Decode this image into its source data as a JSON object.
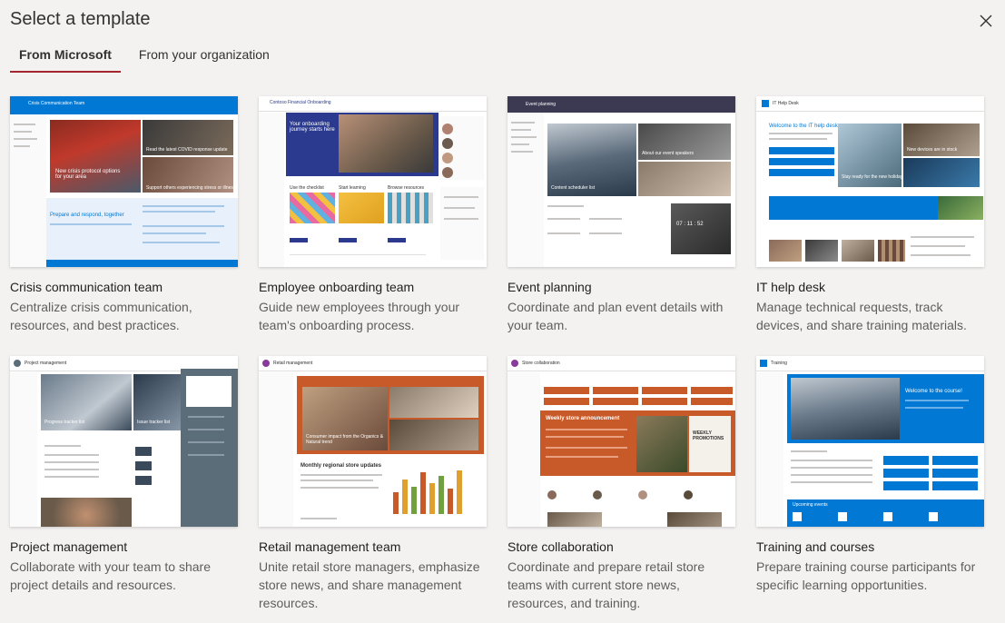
{
  "dialog": {
    "title": "Select a template",
    "close_icon": "close-icon"
  },
  "tabs": [
    {
      "label": "From Microsoft",
      "active": true
    },
    {
      "label": "From your organization",
      "active": false
    }
  ],
  "templates": [
    {
      "title": "Crisis communication team",
      "description": "Centralize crisis communication, resources, and best practices.",
      "accent": "#0078d4",
      "thumb": {
        "site": "Crisis Communication Team",
        "hero": "New crisis protocol options for your area",
        "tile1": "Read the latest COVID response update",
        "tile2": "Support others experiencing stress or illness",
        "section": "Prepare and respond, together"
      }
    },
    {
      "title": "Employee onboarding team",
      "description": "Guide new employees through your team's onboarding process.",
      "accent": "#2b3a8f",
      "thumb": {
        "site": "Contoso Financial Onboarding",
        "hero": "Your onboarding journey starts here",
        "col1": "Use the checklist",
        "col2": "Start learning",
        "col3": "Browse resources"
      }
    },
    {
      "title": "Event planning",
      "description": "Coordinate and plan event details with your team.",
      "accent": "#3b3a52",
      "thumb": {
        "site": "Event planning",
        "hero": "Content scheduler list",
        "tile1": "About our event speakers",
        "counter": "07 : 11 : 52"
      }
    },
    {
      "title": "IT help desk",
      "description": "Manage technical requests, track devices, and share training materials.",
      "accent": "#0078d4",
      "thumb": {
        "site": "IT Help Desk",
        "hero": "Welcome to the IT help desk",
        "tile1": "New devices are in stock",
        "tile2": "Stay ready for the new holidays"
      }
    },
    {
      "title": "Project management",
      "description": "Collaborate with your team to share project details and resources.",
      "accent": "#5c6d7a",
      "thumb": {
        "site": "Project management",
        "tile1": "Progress tracker list",
        "tile2": "Issue tracker list"
      }
    },
    {
      "title": "Retail management team",
      "description": "Unite retail store managers, emphasize store news, and share management resources.",
      "accent": "#c85a2a",
      "thumb": {
        "site": "Retail management",
        "hero": "Consumer impact from the Organics & Natural trend",
        "section": "Monthly regional store updates"
      }
    },
    {
      "title": "Store collaboration",
      "description": "Coordinate and prepare retail store teams with current store news, resources, and training.",
      "accent": "#c85a2a",
      "thumb": {
        "site": "Store collaboration",
        "section": "Weekly store announcement",
        "promo": "WEEKLY PROMOTIONS"
      }
    },
    {
      "title": "Training and courses",
      "description": "Prepare training course participants for specific learning opportunities.",
      "accent": "#0078d4",
      "thumb": {
        "site": "Training",
        "hero": "Welcome to the course!",
        "section": "Upcoming events"
      }
    }
  ]
}
